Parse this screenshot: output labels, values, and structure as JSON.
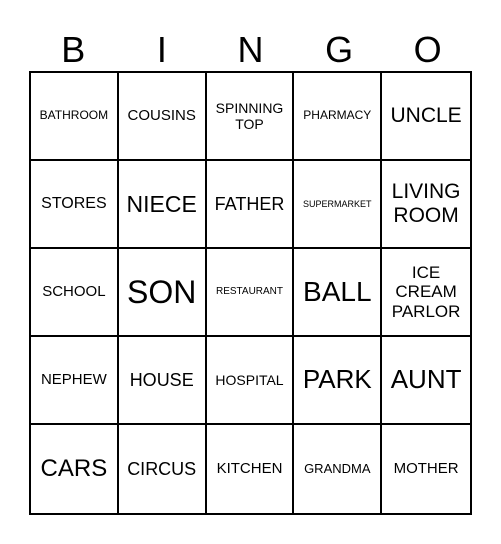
{
  "header": {
    "letters": [
      "B",
      "I",
      "N",
      "G",
      "O"
    ]
  },
  "cells": [
    {
      "text": "BATHROOM",
      "size": 12
    },
    {
      "text": "COUSINS",
      "size": 15
    },
    {
      "text": "SPINNING TOP",
      "size": 14
    },
    {
      "text": "PHARMACY",
      "size": 12
    },
    {
      "text": "UNCLE",
      "size": 21
    },
    {
      "text": "STORES",
      "size": 16
    },
    {
      "text": "NIECE",
      "size": 23
    },
    {
      "text": "FATHER",
      "size": 18
    },
    {
      "text": "SUPERMARKET",
      "size": 9
    },
    {
      "text": "LIVING ROOM",
      "size": 21
    },
    {
      "text": "SCHOOL",
      "size": 15
    },
    {
      "text": "SON",
      "size": 32
    },
    {
      "text": "RESTAURANT",
      "size": 10
    },
    {
      "text": "BALL",
      "size": 28
    },
    {
      "text": "ICE CREAM PARLOR",
      "size": 17
    },
    {
      "text": "NEPHEW",
      "size": 15
    },
    {
      "text": "HOUSE",
      "size": 18
    },
    {
      "text": "HOSPITAL",
      "size": 14
    },
    {
      "text": "PARK",
      "size": 26
    },
    {
      "text": "AUNT",
      "size": 26
    },
    {
      "text": "CARS",
      "size": 24
    },
    {
      "text": "CIRCUS",
      "size": 18
    },
    {
      "text": "KITCHEN",
      "size": 15
    },
    {
      "text": "GRANDMA",
      "size": 13
    },
    {
      "text": "MOTHER",
      "size": 15
    }
  ]
}
